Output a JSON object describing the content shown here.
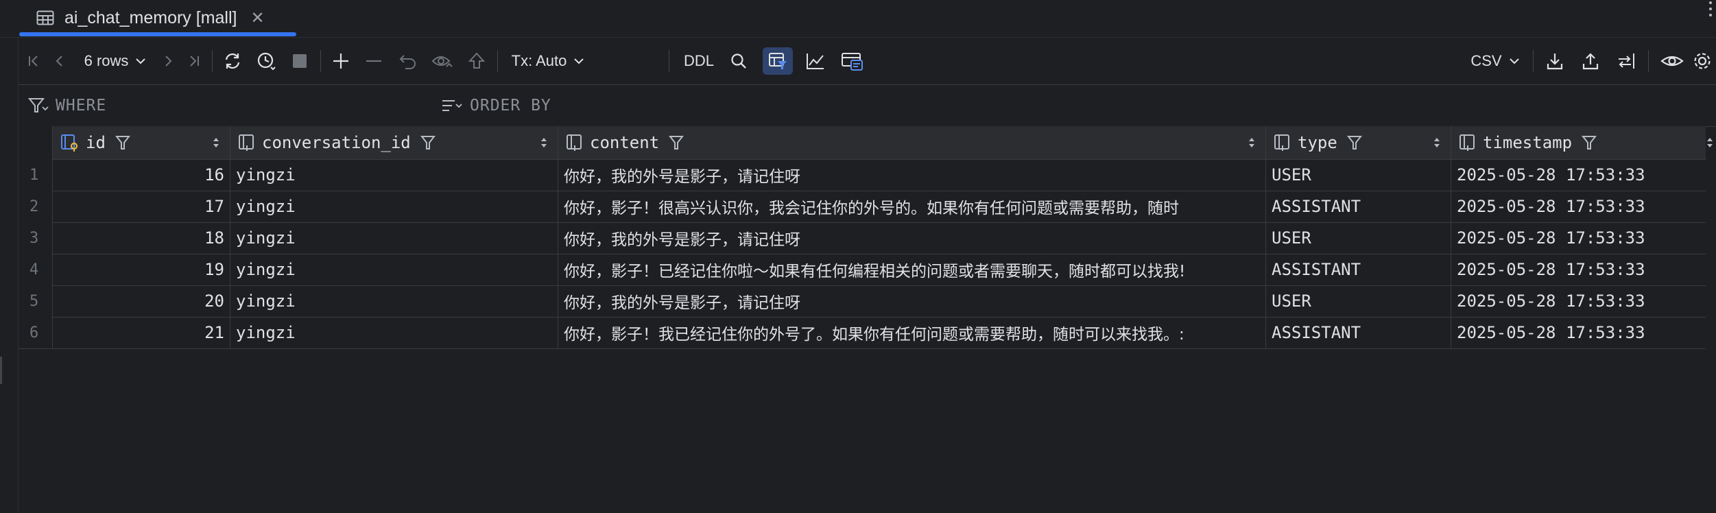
{
  "tab": {
    "title": "ai_chat_memory [mall]",
    "close_glyph": "✕",
    "icon": "table-icon"
  },
  "toolbar": {
    "rows_label": "6 rows",
    "tx_label": "Tx: Auto",
    "ddl_label": "DDL",
    "export_format": "CSV"
  },
  "filter": {
    "where_placeholder": "WHERE",
    "order_placeholder": "ORDER BY"
  },
  "table": {
    "columns": [
      {
        "name": "id",
        "icon": "primary-key-column-icon"
      },
      {
        "name": "conversation_id",
        "icon": "column-icon"
      },
      {
        "name": "content",
        "icon": "column-icon"
      },
      {
        "name": "type",
        "icon": "column-icon"
      },
      {
        "name": "timestamp",
        "icon": "column-icon"
      }
    ],
    "rows": [
      {
        "n": "1",
        "id": "16",
        "conversation_id": "yingzi",
        "content": "你好，我的外号是影子，请记住呀",
        "type": "USER",
        "timestamp": "2025-05-28 17:53:33"
      },
      {
        "n": "2",
        "id": "17",
        "conversation_id": "yingzi",
        "content": "你好，影子！很高兴认识你，我会记住你的外号的。如果你有任何问题或需要帮助，随时",
        "type": "ASSISTANT",
        "timestamp": "2025-05-28 17:53:33"
      },
      {
        "n": "3",
        "id": "18",
        "conversation_id": "yingzi",
        "content": "你好，我的外号是影子，请记住呀",
        "type": "USER",
        "timestamp": "2025-05-28 17:53:33"
      },
      {
        "n": "4",
        "id": "19",
        "conversation_id": "yingzi",
        "content": "你好，影子！已经记住你啦～如果有任何编程相关的问题或者需要聊天，随时都可以找我!",
        "type": "ASSISTANT",
        "timestamp": "2025-05-28 17:53:33"
      },
      {
        "n": "5",
        "id": "20",
        "conversation_id": "yingzi",
        "content": "你好，我的外号是影子，请记住呀",
        "type": "USER",
        "timestamp": "2025-05-28 17:53:33"
      },
      {
        "n": "6",
        "id": "21",
        "conversation_id": "yingzi",
        "content": "你好，影子！我已经记住你的外号了。如果你有任何问题或需要帮助，随时可以来找我。:",
        "type": "ASSISTANT",
        "timestamp": "2025-05-28 17:53:33"
      }
    ]
  },
  "colors": {
    "background": "#1e1f22",
    "header_background": "#2b2d30",
    "accent": "#3574f0",
    "active_button": "#2e436e",
    "key_icon": "#e8b63c"
  }
}
